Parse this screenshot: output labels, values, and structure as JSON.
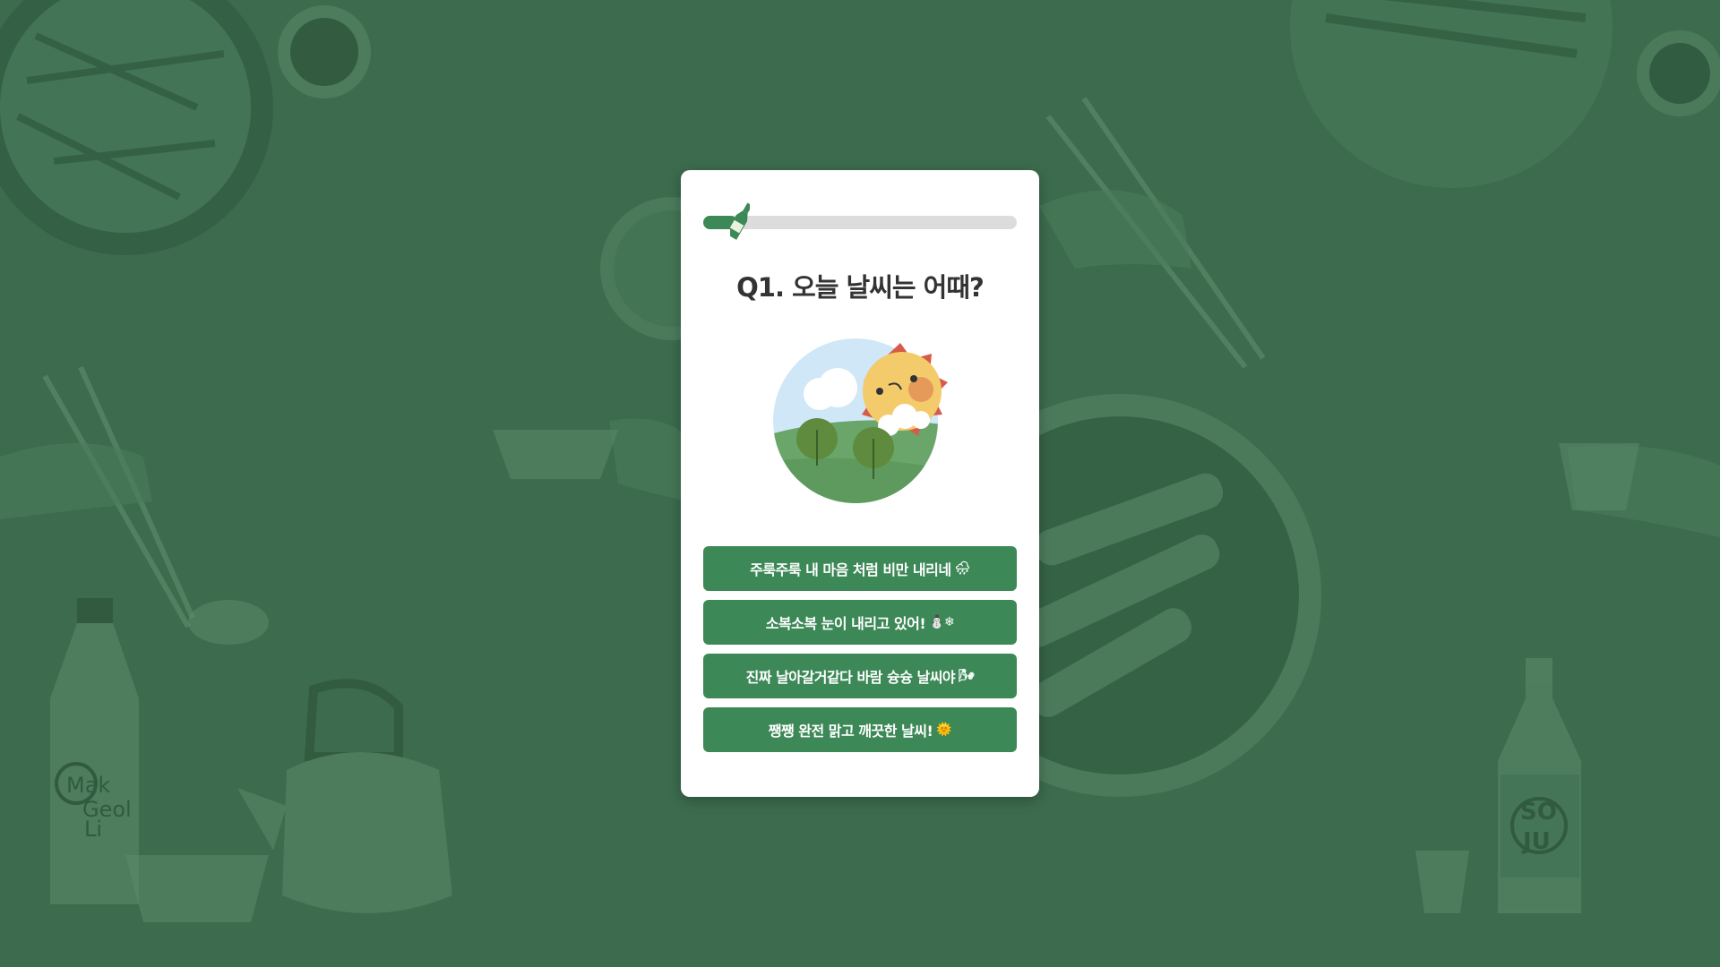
{
  "progress": {
    "value": 0.08
  },
  "question": {
    "text": "Q1. 오늘 날씨는 어때?"
  },
  "answers": [
    {
      "label": "주룩주룩 내 마음 처럼 비만 내리네",
      "emoji": "🌧"
    },
    {
      "label": "소복소복 눈이 내리고 있어!",
      "emoji": "⛄❄"
    },
    {
      "label": "진짜 날아갈거같다 바람 슝슝 날씨야",
      "emoji": "🌬"
    },
    {
      "label": "쨍쨍 완전 맑고 깨끗한 날씨!",
      "emoji": "🌞"
    }
  ],
  "background": {
    "makgeolli_label": [
      "Mak",
      "Geol",
      "Li"
    ],
    "soju_label": [
      "SO",
      "JU"
    ]
  },
  "colors": {
    "background": "#3c6b4d",
    "accent": "#3c8857",
    "progress_track": "#dcdcdc",
    "card": "#ffffff",
    "question_text": "#333333"
  }
}
